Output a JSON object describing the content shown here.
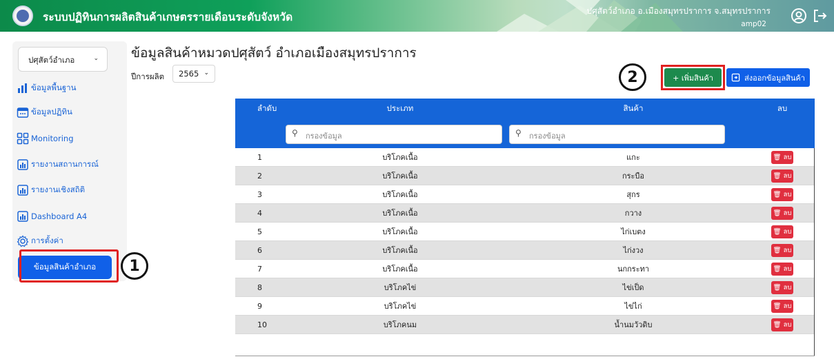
{
  "header": {
    "title": "ระบบปฏิทินการผลิตสินค้าเกษตรรายเดือนระดับจังหวัด",
    "user_location": "ปศุสัตว์อำเภอ อ.เมืองสมุทรปราการ จ.สมุทรปราการ",
    "user_code": "amp02",
    "user_icon": "user-circle-icon",
    "logout_icon": "logout-icon"
  },
  "sidebar": {
    "category_select": "ปศุสัตว์อำเภอ",
    "items": [
      {
        "label": "ข้อมูลพื้นฐาน",
        "icon": "bar-chart-icon"
      },
      {
        "label": "ข้อมูลปฏิทิน",
        "icon": "calendar-icon"
      },
      {
        "label": "Monitoring",
        "icon": "grid-icon"
      },
      {
        "label": "รายงานสถานการณ์",
        "icon": "report-icon"
      },
      {
        "label": "รายงานเชิงสถิติ",
        "icon": "report-icon"
      },
      {
        "label": "Dashboard A4",
        "icon": "report-icon"
      },
      {
        "label": "การตั้งค่า",
        "icon": "gear-icon"
      }
    ],
    "active_item": "ข้อมูลสินค้าอำเภอ"
  },
  "main": {
    "title": "ข้อมูลสินค้าหมวดปศุสัตว์ อำเภอเมืองสมุทรปราการ",
    "year_label": "ปีการผลิต",
    "year_value": "2565",
    "add_button": "+ เพิ่มสินค้า",
    "export_button": "ส่งออกข้อมูลสินค้า",
    "export_icon": "export-icon"
  },
  "annotations": {
    "badge1": "1",
    "badge2": "2"
  },
  "table": {
    "headers": {
      "index": "ลำดับ",
      "type": "ประเภท",
      "product": "สินค้า",
      "delete": "ลบ"
    },
    "filter_placeholder": "กรองข้อมูล",
    "delete_label": "ลบ",
    "rows": [
      {
        "index": "1",
        "type": "บริโภคเนื้อ",
        "product": "แกะ"
      },
      {
        "index": "2",
        "type": "บริโภคเนื้อ",
        "product": "กระบือ"
      },
      {
        "index": "3",
        "type": "บริโภคเนื้อ",
        "product": "สุกร"
      },
      {
        "index": "4",
        "type": "บริโภคเนื้อ",
        "product": "กวาง"
      },
      {
        "index": "5",
        "type": "บริโภคเนื้อ",
        "product": "ไก่เบตง"
      },
      {
        "index": "6",
        "type": "บริโภคเนื้อ",
        "product": "ไก่งวง"
      },
      {
        "index": "7",
        "type": "บริโภคเนื้อ",
        "product": "นกกระทา"
      },
      {
        "index": "8",
        "type": "บริโภคไข่",
        "product": "ไข่เป็ด"
      },
      {
        "index": "9",
        "type": "บริโภคไข่",
        "product": "ไข่ไก่"
      },
      {
        "index": "10",
        "type": "บริโภคนม",
        "product": "น้ำนมวัวดิบ"
      }
    ]
  },
  "colors": {
    "primary": "#1060e8",
    "success": "#1d8a4d",
    "danger": "#e02f3f",
    "header_green": "#0fa05a",
    "highlight": "#e02020"
  }
}
